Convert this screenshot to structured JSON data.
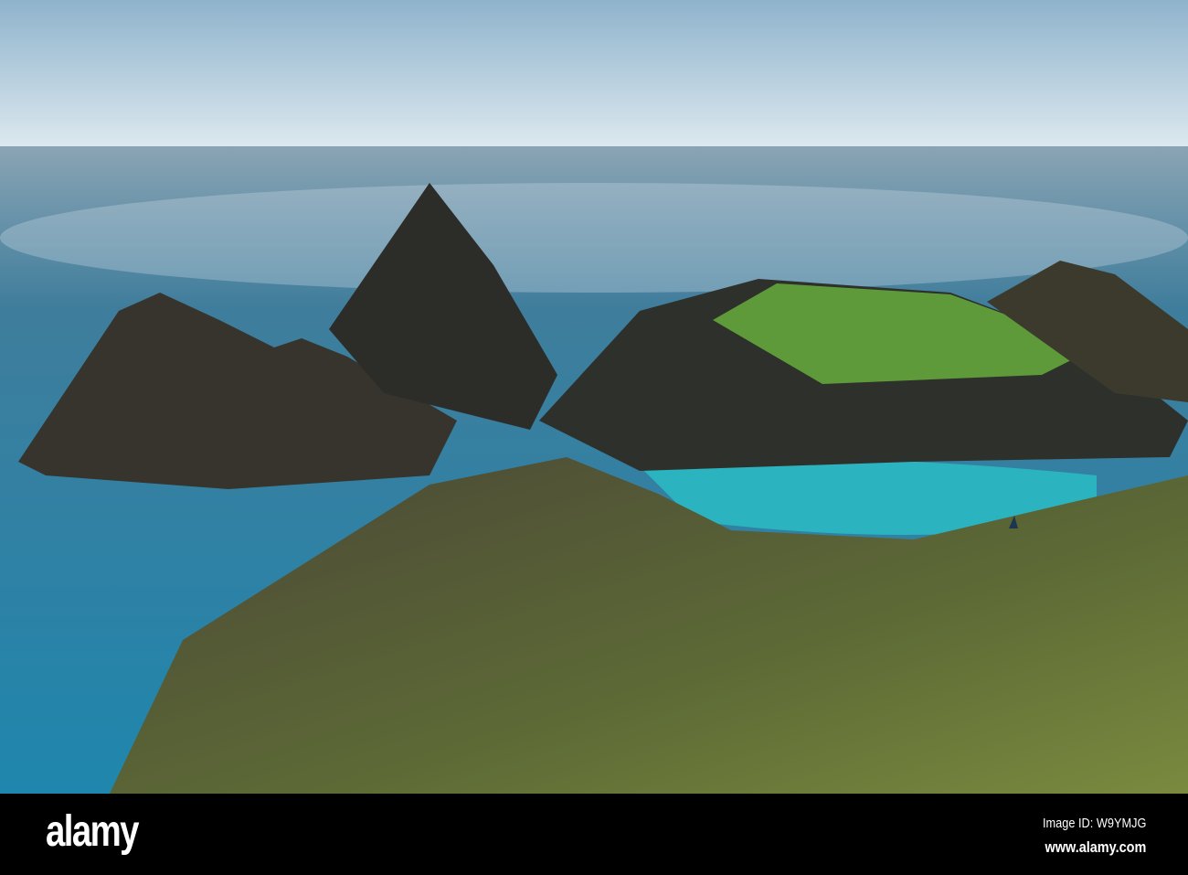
{
  "photo": {
    "subject": "coastal rock islands and turquoise cove"
  },
  "footer": {
    "logo": "alamy",
    "image_id": "Image ID: W9YMJG",
    "website": "www.alamy.com"
  },
  "colors": {
    "sky": "#c9dbe6",
    "sea": "#2b7fa3",
    "cove": "#2bb3bf",
    "rock": "#2a2a2a",
    "grass": "#5e9a3a"
  }
}
